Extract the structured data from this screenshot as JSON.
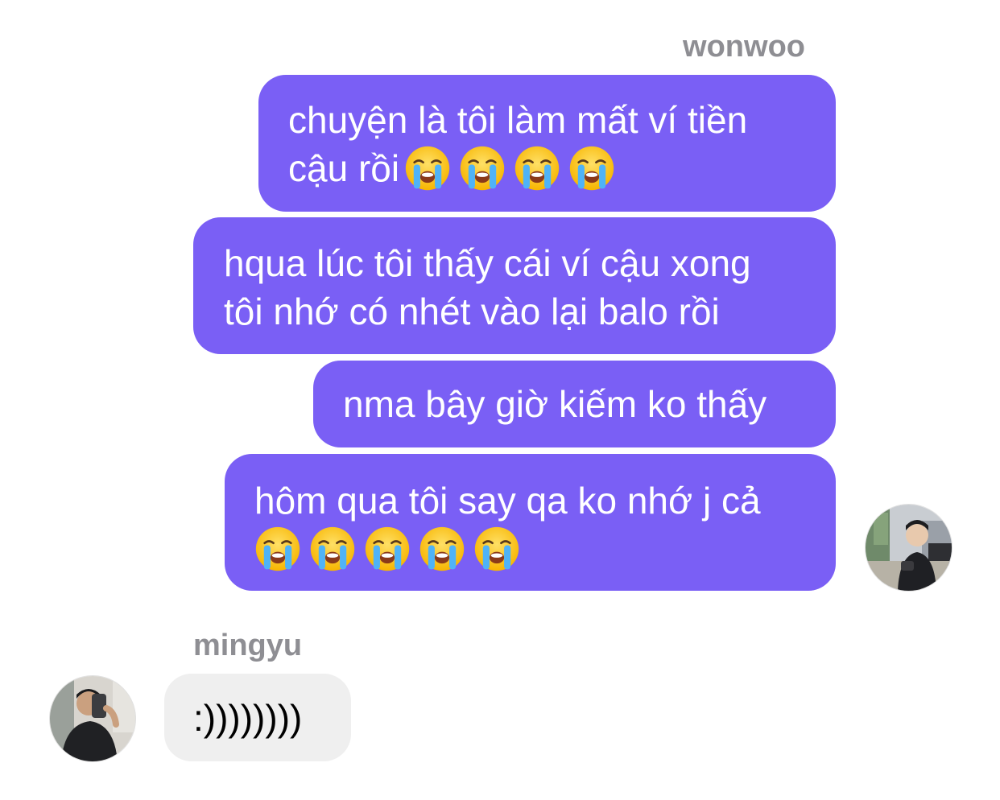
{
  "thread": {
    "outgoing": {
      "sender": "wonwoo",
      "messages": [
        {
          "lines": [
            "chuyện là tôi làm mất ví tiền",
            "cậu rồi"
          ],
          "emoji_count": 4
        },
        {
          "lines": [
            "hqua lúc tôi thấy cái ví cậu xong",
            "tôi nhớ có nhét vào lại balo rồi"
          ],
          "emoji_count": 0
        },
        {
          "lines": [
            "nma bây giờ kiếm ko thấy"
          ],
          "emoji_count": 0
        },
        {
          "lines": [
            "hôm qua tôi say qa ko nhớ j cả"
          ],
          "emoji_count": 5
        }
      ],
      "bubble_color": "#7a5ff5",
      "emoji_icon": "loudly-crying-face-icon"
    },
    "incoming": {
      "sender": "mingyu",
      "messages": [
        {
          "lines": [
            ":))))))))"
          ]
        }
      ],
      "bubble_color": "#efefef"
    }
  }
}
